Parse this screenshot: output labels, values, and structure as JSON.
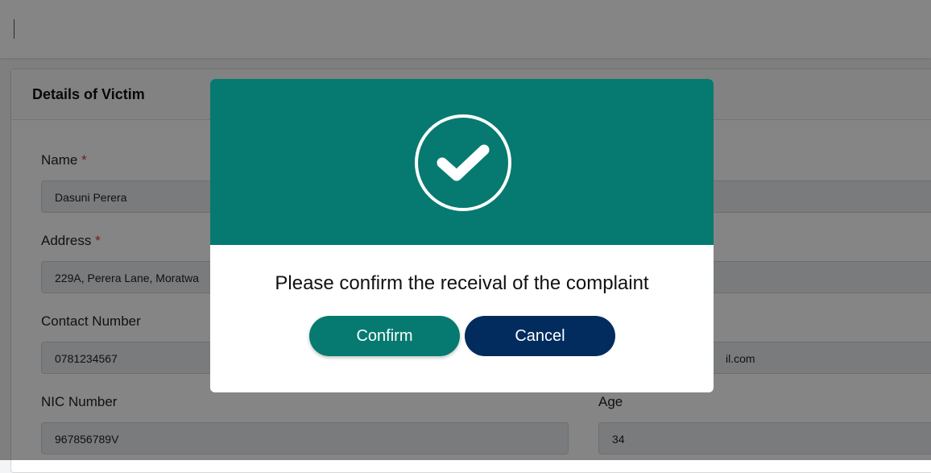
{
  "form": {
    "section_title": "Details of Victim",
    "required_marker": "*",
    "fields": {
      "name": {
        "label": "Name",
        "value": "Dasuni Perera"
      },
      "address": {
        "label": "Address",
        "value": "229A, Perera Lane, Moratwa"
      },
      "contact": {
        "label": "Contact Number",
        "value": "0781234567"
      },
      "email_partial": {
        "value": "il.com"
      },
      "nic": {
        "label": "NIC Number",
        "value": "967856789V"
      },
      "age": {
        "label": "Age",
        "value": "34"
      }
    }
  },
  "modal": {
    "icon": "check-icon",
    "message": "Please confirm the receival of the complaint",
    "confirm_label": "Confirm",
    "cancel_label": "Cancel",
    "colors": {
      "header": "#067a70",
      "confirm": "#067a70",
      "cancel": "#022c5e"
    }
  }
}
